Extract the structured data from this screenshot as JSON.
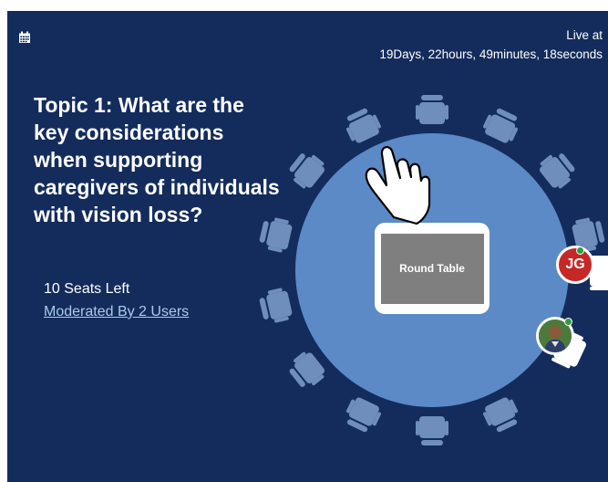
{
  "header": {
    "live_label": "Live at",
    "countdown": "19Days,  22hours,  49minutes,  18seconds",
    "calendar_icon": "calendar-icon"
  },
  "topic": {
    "title": "Topic 1: What are the key considerations when supporting caregivers of individuals with vision loss?",
    "seats_left": "10 Seats Left",
    "moderated_by": "Moderated By 2 Users"
  },
  "table": {
    "label": "Round Table",
    "colors": {
      "panel": "#142c5c",
      "table": "#5b8ac6",
      "chair": "#6f8ebb",
      "screen": "#7f7f7f"
    }
  },
  "participants": [
    {
      "initials": "JG",
      "status": "online",
      "color": "#c62828"
    },
    {
      "initials": "",
      "status": "online",
      "avatar": "photo-avatar"
    }
  ],
  "cursor_icon": "pointing-hand-icon"
}
